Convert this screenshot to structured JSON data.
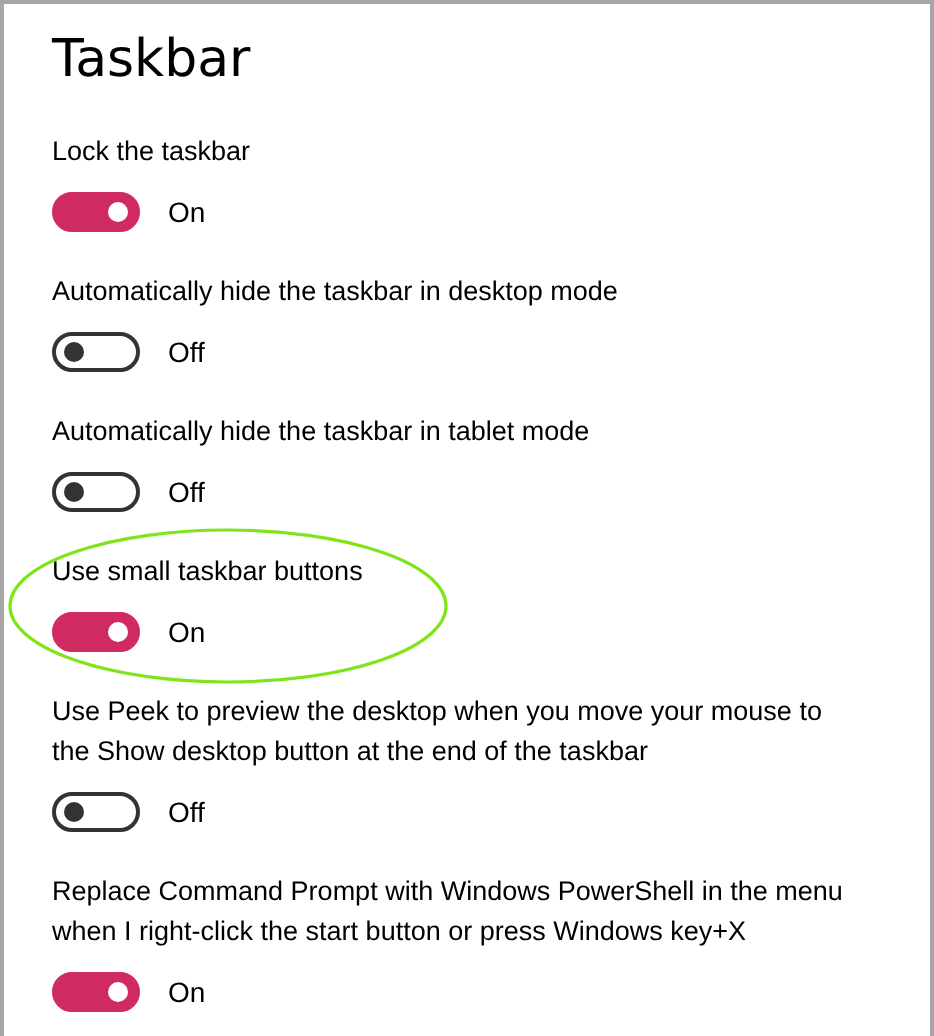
{
  "title": "Taskbar",
  "settings": [
    {
      "label_lines": [
        "Lock the taskbar"
      ],
      "on": true,
      "state_text": "On",
      "highlighted": false
    },
    {
      "label_lines": [
        "Automatically hide the taskbar in desktop mode"
      ],
      "on": false,
      "state_text": "Off",
      "highlighted": false
    },
    {
      "label_lines": [
        "Automatically hide the taskbar in tablet mode"
      ],
      "on": false,
      "state_text": "Off",
      "highlighted": false
    },
    {
      "label_lines": [
        "Use small taskbar buttons"
      ],
      "on": true,
      "state_text": "On",
      "highlighted": true
    },
    {
      "label_lines": [
        "Use Peek to preview the desktop when you move your mouse to",
        "the Show desktop button at the end of the taskbar"
      ],
      "on": false,
      "state_text": "Off",
      "highlighted": false
    },
    {
      "label_lines": [
        "Replace Command Prompt with Windows PowerShell in the menu",
        "when I right-click the start button or press Windows key+X"
      ],
      "on": true,
      "state_text": "On",
      "highlighted": false
    }
  ]
}
